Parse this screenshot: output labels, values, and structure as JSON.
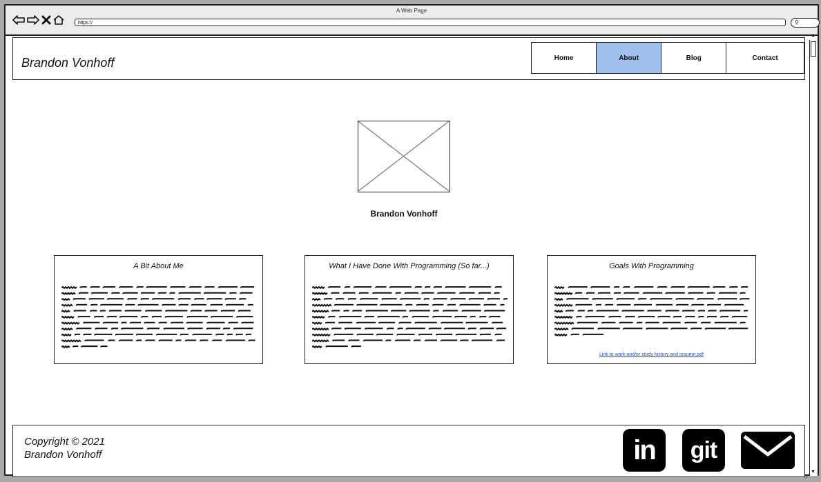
{
  "window": {
    "title": "A Web Page",
    "url": "https://",
    "nav_icons": [
      "back-arrow-icon",
      "forward-arrow-icon",
      "close-x-icon",
      "home-icon"
    ]
  },
  "header": {
    "brand": "Brandon Vonhoff",
    "nav": [
      {
        "label": "Home",
        "active": false
      },
      {
        "label": "About",
        "active": true
      },
      {
        "label": "Blog",
        "active": false
      },
      {
        "label": "Contact",
        "active": false
      }
    ]
  },
  "profile": {
    "name": "Brandon Vonhoff"
  },
  "cards": [
    {
      "title": "A Bit About Me",
      "link": ""
    },
    {
      "title": "What I Have Done With Programming (So far...)",
      "link": ""
    },
    {
      "title": "Goals With Programming",
      "link": "Link to work and/or study history and resume.pdf"
    }
  ],
  "footer": {
    "copyright_line1": "Copyright © 2021",
    "copyright_line2": "Brandon Vonhoff",
    "social": [
      {
        "label": "in",
        "icon": "linkedin-icon"
      },
      {
        "label": "git",
        "icon": "git-icon"
      },
      {
        "label": "",
        "icon": "envelope-icon"
      }
    ]
  },
  "colors": {
    "active_tab": "#a0c0ee",
    "link": "#1b4fc4",
    "icon_bg": "#000000"
  }
}
